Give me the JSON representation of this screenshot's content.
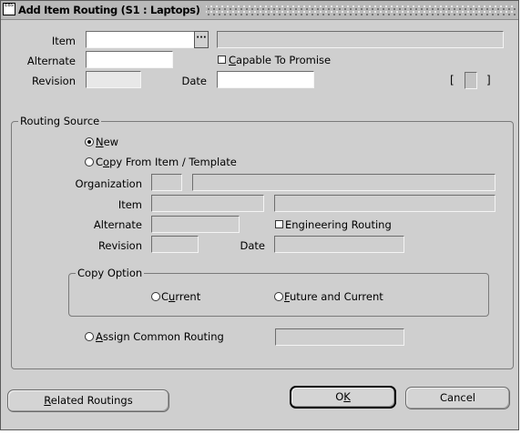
{
  "window": {
    "title": "Add Item Routing (S1 : Laptops)",
    "app_icon_text": "EBS"
  },
  "header": {
    "item_label": "Item",
    "item_value": "",
    "item_description": "",
    "alternate_label": "Alternate",
    "alternate_value": "",
    "capable_to_promise_label_pre": "",
    "capable_to_promise_hotkey": "C",
    "capable_to_promise_label_rest": "apable To Promise",
    "capable_to_promise_checked": false,
    "revision_label": "Revision",
    "revision_value": "",
    "date_label": "Date",
    "date_value": "",
    "bracket_open": "[",
    "bracket_close": "]"
  },
  "routing_source": {
    "title": "Routing Source",
    "new_hotkey": "N",
    "new_rest": "ew",
    "new_selected": true,
    "copy_from_pre": "C",
    "copy_from_hotkey": "o",
    "copy_from_rest": "py From Item / Template",
    "organization_label": "Organization",
    "item_label": "Item",
    "alternate_label": "Alternate",
    "engineering_routing_label": "Engineering Routing",
    "engineering_routing_checked": false,
    "revision_label": "Revision",
    "date_label": "Date",
    "copy_option": {
      "title": "Copy Option",
      "current_pre": "C",
      "current_hotkey": "u",
      "current_rest": "rrent",
      "future_hotkey": "F",
      "future_rest": "uture and Current"
    },
    "assign_common_hotkey": "A",
    "assign_common_rest": "ssign Common Routing"
  },
  "buttons": {
    "related_pre": "",
    "related_hotkey": "R",
    "related_rest": "elated Routings",
    "ok_pre": "O",
    "ok_hotkey": "K",
    "cancel": "Cancel"
  }
}
